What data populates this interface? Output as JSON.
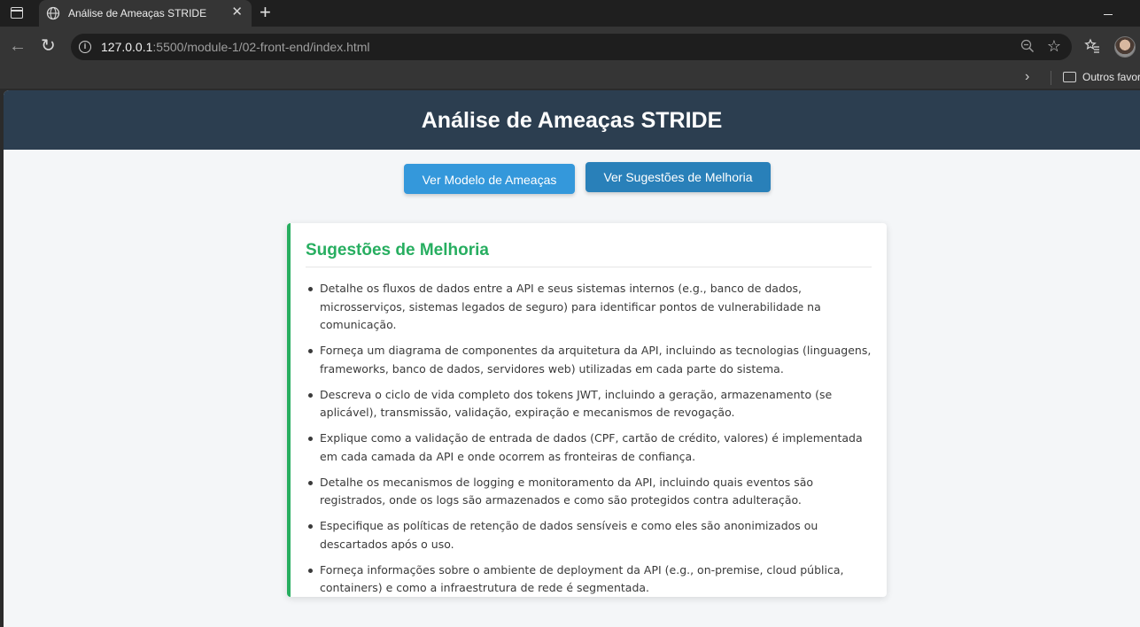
{
  "browser": {
    "tab_title": "Análise de Ameaças STRIDE",
    "url_host": "127.0.0.1",
    "url_path": ":5500/module-1/02-front-end/index.html",
    "bookmarks_folder": "Outros favoritos",
    "icons": [
      "window-icon",
      "globe-icon",
      "close-icon",
      "new-tab-icon",
      "minimize-icon",
      "back-icon",
      "reload-icon",
      "site-info-icon",
      "zoom-icon",
      "star-icon",
      "favorites-icon",
      "profile-avatar",
      "chevron-right-icon",
      "folder-icon"
    ]
  },
  "page": {
    "title": "Análise de Ameaças STRIDE",
    "buttons": {
      "model": "Ver Modelo de Ameaças",
      "suggestions": "Ver Sugestões de Melhoria"
    },
    "suggestions": {
      "heading": "Sugestões de Melhoria",
      "items": [
        "Detalhe os fluxos de dados entre a API e seus sistemas internos (e.g., banco de dados, microsserviços, sistemas legados de seguro) para identificar pontos de vulnerabilidade na comunicação.",
        "Forneça um diagrama de componentes da arquitetura da API, incluindo as tecnologias (linguagens, frameworks, banco de dados, servidores web) utilizadas em cada parte do sistema.",
        "Descreva o ciclo de vida completo dos tokens JWT, incluindo a geração, armazenamento (se aplicável), transmissão, validação, expiração e mecanismos de revogação.",
        "Explique como a validação de entrada de dados (CPF, cartão de crédito, valores) é implementada em cada camada da API e onde ocorrem as fronteiras de confiança.",
        "Detalhe os mecanismos de logging e monitoramento da API, incluindo quais eventos são registrados, onde os logs são armazenados e como são protegidos contra adulteração.",
        "Especifique as políticas de retenção de dados sensíveis e como eles são anonimizados ou descartados após o uso.",
        "Forneça informações sobre o ambiente de deployment da API (e.g., on-premise, cloud pública, containers) e como a infraestrutura de rede é segmentada."
      ]
    }
  },
  "colors": {
    "header_bg": "#2c3e50",
    "btn_model": "#3498db",
    "btn_suggest": "#2980b9",
    "accent_green": "#27ae60"
  }
}
